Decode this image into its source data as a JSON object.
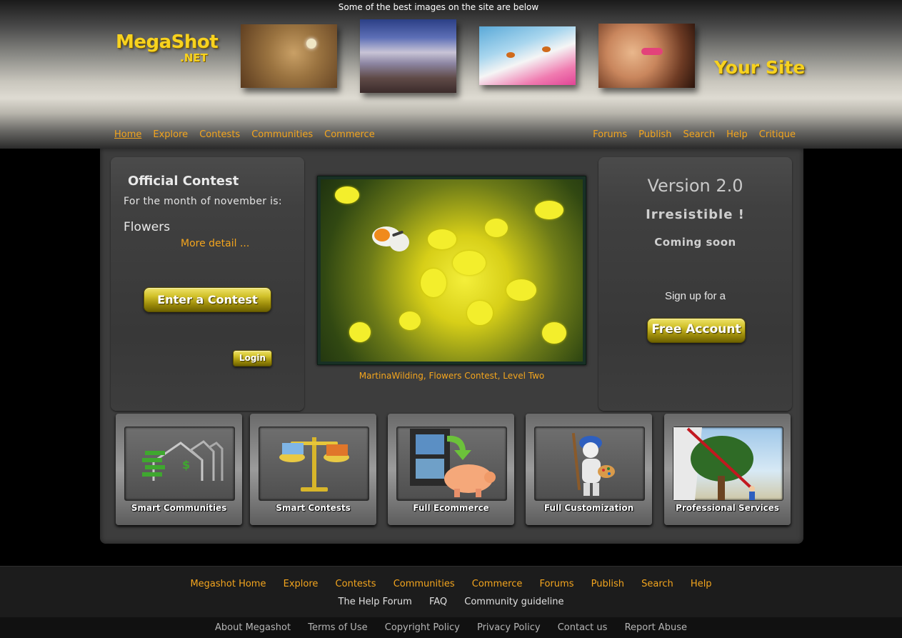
{
  "header": {
    "tagline": "Some of the best images on the site are below",
    "logo_main": "MegaShot",
    "logo_suffix": ".NET",
    "your_site": "Your Site",
    "nav_left": [
      "Home",
      "Explore",
      "Contests",
      "Communities",
      "Commerce"
    ],
    "nav_right": [
      "Forums",
      "Publish",
      "Search",
      "Help",
      "Critique"
    ]
  },
  "contest_panel": {
    "title": "Official Contest",
    "subtitle": "For the month of  november is:",
    "theme": "Flowers",
    "more_detail": "More detail ...",
    "enter_button": "Enter a Contest",
    "login_button": "Login"
  },
  "featured": {
    "caption": "MartinaWilding, Flowers Contest, Level Two"
  },
  "version_panel": {
    "title": "Version 2.0",
    "subtitle": "Irresistible !",
    "coming_soon": "Coming soon",
    "signup_text": "Sign up for a",
    "free_account_button": "Free Account"
  },
  "features": [
    {
      "label": "Smart Communities",
      "icon": "houses-icon"
    },
    {
      "label": "Smart Contests",
      "icon": "scales-icon"
    },
    {
      "label": "Full Ecommerce",
      "icon": "film-piggybank-icon"
    },
    {
      "label": "Full Customization",
      "icon": "painter-icon"
    },
    {
      "label": "Professional Services",
      "icon": "tree-painter-icon"
    }
  ],
  "footer": {
    "row1": [
      "Megashot Home",
      "Explore",
      "Contests",
      "Communities",
      "Commerce",
      "Forums",
      "Publish",
      "Search",
      "Help"
    ],
    "row2": [
      "The Help Forum",
      "FAQ",
      "Community guideline"
    ],
    "row3": [
      "About Megashot",
      "Terms of Use",
      "Copyright Policy",
      "Privacy Policy",
      "Contact us",
      "Report Abuse"
    ]
  },
  "colors": {
    "accent": "#f3a51e",
    "logo_yellow": "#f7d21f",
    "panel": "#3d3d3d"
  }
}
